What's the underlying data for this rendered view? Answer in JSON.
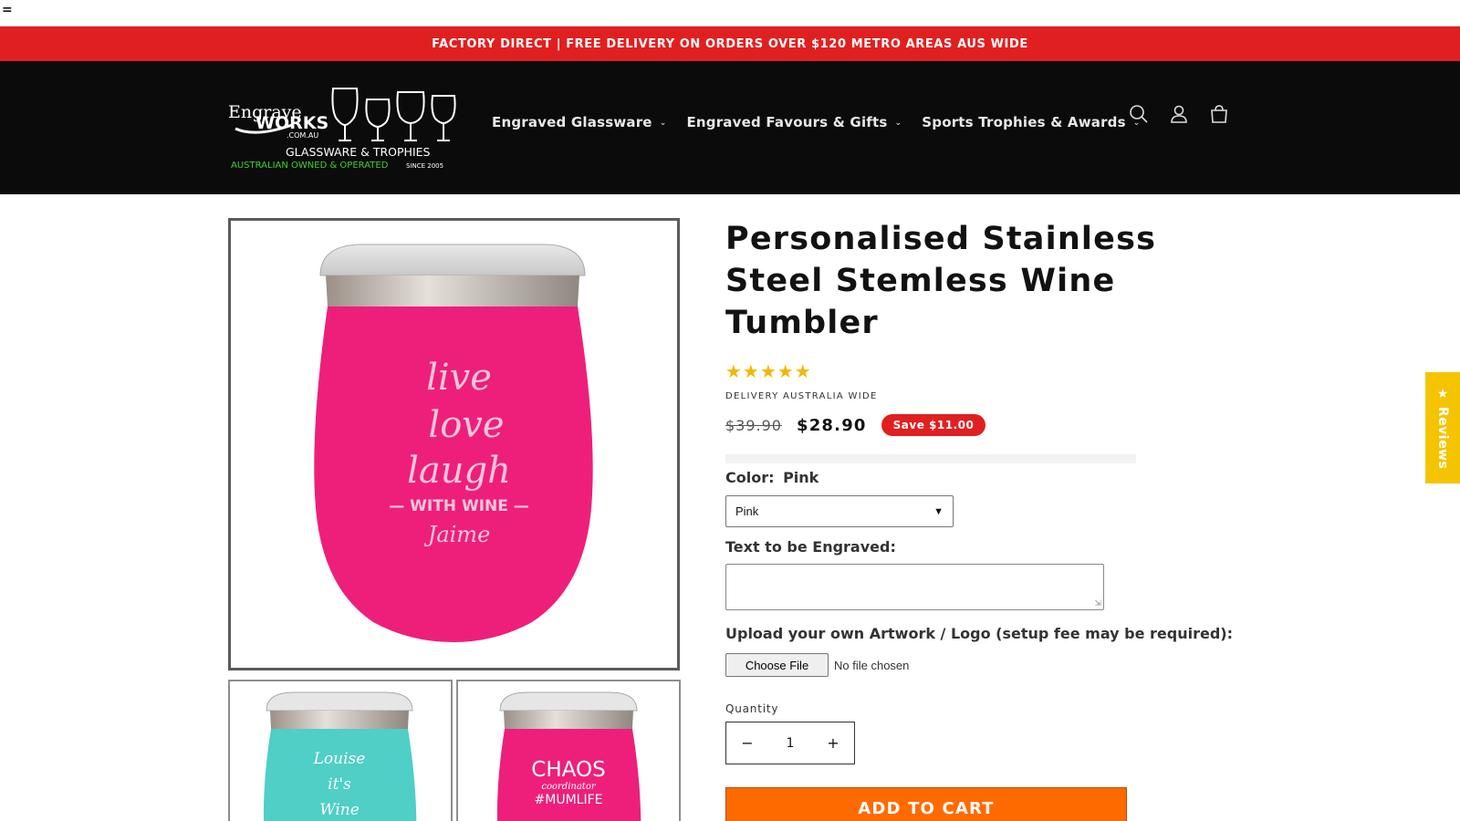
{
  "topbar": {
    "menu_glyph": "="
  },
  "announcement": {
    "text": "FACTORY DIRECT | FREE DELIVERY ON ORDERS OVER $120 METRO AREAS AUS WIDE"
  },
  "logo": {
    "line1": "Engrave",
    "line2": "WORKS",
    "line3": ".COM.AU",
    "tagline": "GLASSWARE & TROPHIES",
    "subline": "AUSTRALIAN OWNED & OPERATED",
    "since": "SINCE 2005"
  },
  "nav": {
    "items": [
      {
        "label": "Engraved Glassware"
      },
      {
        "label": "Engraved Favours & Gifts"
      },
      {
        "label": "Sports Trophies & Awards"
      }
    ]
  },
  "header_icons": [
    "search-icon",
    "account-icon",
    "cart-icon"
  ],
  "product": {
    "title": "Personalised Stainless Steel Stemless Wine Tumbler",
    "rating_stars": "★★★★★",
    "rating": 5,
    "delivery_note": "DELIVERY AUSTRALIA WIDE",
    "price_old": "$39.90",
    "price_new": "$28.90",
    "save_badge": "Save $11.00",
    "color_label": "Color:",
    "color_value": "Pink",
    "color_select_value": "Pink",
    "engrave_label": "Text to be Engraved:",
    "engrave_value": "",
    "upload_label": "Upload your own Artwork / Logo (setup fee may be required):",
    "file_button": "Choose File",
    "file_status": "No file chosen",
    "quantity_label": "Quantity",
    "quantity": "1",
    "qty_minus": "−",
    "qty_plus": "+",
    "add_to_cart": "ADD TO CART"
  },
  "images": {
    "main": {
      "engraving": [
        "live",
        "love",
        "laugh",
        "— WITH WINE —",
        "Jaime"
      ]
    },
    "thumb1": {
      "engraving": [
        "Louise",
        "it's",
        "Wine"
      ]
    },
    "thumb2": {
      "engraving": [
        "CHAOS",
        "coordinator",
        "#MUMLIFE"
      ]
    }
  },
  "reviews_tab": {
    "label": "★ Reviews"
  },
  "colors": {
    "announcement_bg": "#e02020",
    "header_bg": "#0b0b0b",
    "tumbler_pink": "#ee1f7a",
    "tumbler_teal": "#4fcfc6",
    "add_to_cart": "#ff6a00",
    "stars": "#f2b705",
    "reviews_tab": "#f5c400"
  }
}
